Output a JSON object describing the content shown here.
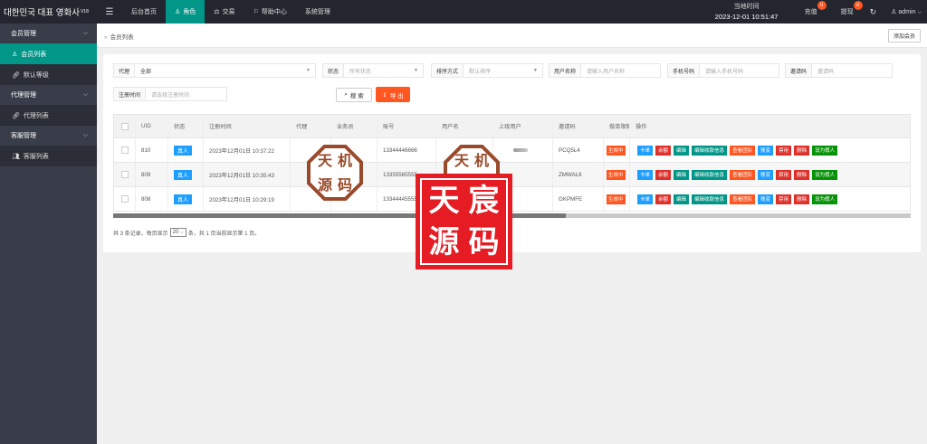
{
  "app": {
    "brand": "대한민국 대표 영화사",
    "version": "V18"
  },
  "nav": [
    {
      "label": "后台首页",
      "icon": ""
    },
    {
      "label": "角色",
      "icon": "user-icon",
      "active": true
    },
    {
      "label": "交易",
      "icon": "scale-icon"
    },
    {
      "label": "帮助中心",
      "icon": "flag-icon"
    },
    {
      "label": "系统管理",
      "icon": ""
    }
  ],
  "topright": {
    "clock_label": "当地时间",
    "clock_value": "2023-12-01 10:51:47",
    "recharge": "充值",
    "recharge_count": "0",
    "withdraw": "提现",
    "withdraw_count": "0",
    "user": "admin"
  },
  "sidebar": [
    {
      "type": "group",
      "label": "会员管理"
    },
    {
      "type": "item",
      "label": "会员列表",
      "icon": "user-icon",
      "active": true
    },
    {
      "type": "item",
      "label": "默认等级",
      "icon": "link-icon"
    },
    {
      "type": "group",
      "label": "代理管理"
    },
    {
      "type": "item",
      "label": "代理列表",
      "icon": "link-icon"
    },
    {
      "type": "group",
      "label": "客服管理"
    },
    {
      "type": "item",
      "label": "客服列表",
      "icon": "users-icon"
    }
  ],
  "tabbar": {
    "crumb": "会员列表",
    "add_member": "添加会员"
  },
  "filters": {
    "agent": {
      "label": "代理",
      "value": "全部"
    },
    "status": {
      "label": "状态",
      "placeholder": "所有状态"
    },
    "sort": {
      "label": "排序方式",
      "placeholder": "默认排序"
    },
    "username": {
      "label": "用户名称",
      "placeholder": "请输入用户名称"
    },
    "phone": {
      "label": "手机号码",
      "placeholder": "请输入手机号码"
    },
    "invite": {
      "label": "邀请码",
      "placeholder": "邀请码"
    },
    "regtime": {
      "label": "注册时间",
      "placeholder": "请选择注册时间"
    },
    "search": "搜 索",
    "export": "导 出"
  },
  "table": {
    "headers": [
      "UID",
      "状态",
      "注册时间",
      "代理",
      "业务员",
      "账号",
      "用户名",
      "上级用户",
      "邀请码",
      "做单限制",
      "操作"
    ],
    "rows": [
      {
        "uid": "810",
        "status": "真人",
        "time": "2023年12月01日 10:37:22",
        "account": "13344446666",
        "invite": "PCQ5L4",
        "limit": "生效中"
      },
      {
        "uid": "809",
        "status": "真人",
        "time": "2023年12月01日 10:35:43",
        "account": "13355565555",
        "invite": "ZMWAL6",
        "limit": "生效中"
      },
      {
        "uid": "808",
        "status": "真人",
        "time": "2023年12月01日 10:29:19",
        "account": "13344445555",
        "invite": "GKPMFE",
        "limit": "生效中"
      }
    ],
    "ops": [
      {
        "label": "卡单",
        "color": "blue"
      },
      {
        "label": "余额",
        "color": "red"
      },
      {
        "label": "编辑",
        "color": "green"
      },
      {
        "label": "编辑收款信息",
        "color": "green"
      },
      {
        "label": "查看团队",
        "color": "orange"
      },
      {
        "label": "账变",
        "color": "blue"
      },
      {
        "label": "禁用",
        "color": "red"
      },
      {
        "label": "删除",
        "color": "red"
      },
      {
        "label": "设为假人",
        "color": "dgreen"
      }
    ]
  },
  "pager": {
    "prefix": "共 3 条记录，每页显示",
    "per_page": "20",
    "suffix": "条，共 1 页当前显示第 1 页。"
  },
  "watermarks": {
    "stamp1": [
      "天",
      "机",
      "源",
      "码"
    ],
    "stamp2": [
      "天",
      "机",
      "源",
      "码"
    ],
    "stamp3": [
      "天",
      "宸",
      "源",
      "码"
    ]
  }
}
